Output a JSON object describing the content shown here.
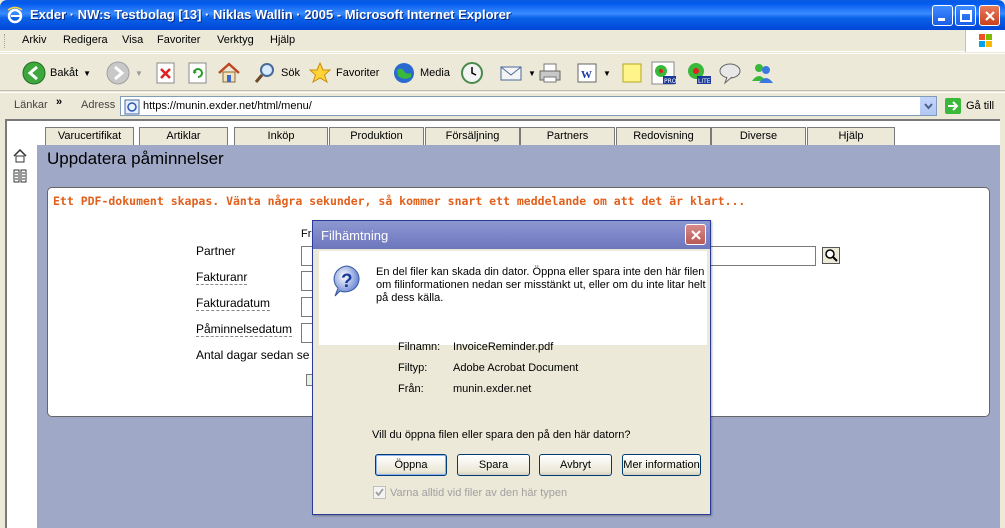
{
  "window": {
    "title": "Exder · NW:s Testbolag [13] · Niklas Wallin · 2005 - Microsoft Internet Explorer"
  },
  "menubar": {
    "items": [
      "Arkiv",
      "Redigera",
      "Visa",
      "Favoriter",
      "Verktyg",
      "Hjälp"
    ]
  },
  "toolbar": {
    "back_label": "Bakåt",
    "search_label": "Sök",
    "favorites_label": "Favoriter",
    "media_label": "Media"
  },
  "addressbar": {
    "links_label": "Länkar",
    "address_label": "Adress",
    "url": "https://munin.exder.net/html/menu/",
    "go_label": "Gå till"
  },
  "nav": {
    "tabs": [
      "Varucertifikat",
      "Artiklar",
      "Inköp",
      "Produktion",
      "Försäljning",
      "Partners",
      "Redovisning",
      "Diverse",
      "Hjälp"
    ]
  },
  "page": {
    "title": "Uppdatera påminnelser",
    "message": "Ett PDF-dokument skapas. Vänta några sekunder, så kommer snart ett meddelande om att det är klart...",
    "col_header": "Fr",
    "fields": {
      "partner": "Partner",
      "invoice_no": "Fakturanr",
      "invoice_date": "Fakturadatum",
      "reminder_date": "Påminnelsedatum",
      "days_since": "Antal dagar sedan se"
    }
  },
  "dialog": {
    "title": "Filhämtning",
    "warning": "En del filer kan skada din dator. Öppna eller spara inte den här filen om filinformationen nedan ser misstänkt ut, eller om du inte litar helt på dess källa.",
    "info": [
      {
        "label": "Filnamn:",
        "value": "InvoiceReminder.pdf"
      },
      {
        "label": "Filtyp:",
        "value": "Adobe Acrobat Document"
      },
      {
        "label": "Från:",
        "value": "munin.exder.net"
      }
    ],
    "question": "Vill du öppna filen eller spara den på den här datorn?",
    "buttons": {
      "open": "Öppna",
      "save": "Spara",
      "cancel": "Avbryt",
      "more_info": "Mer information"
    },
    "checkbox_label": "Varna alltid vid filer av den här typen",
    "checkbox_checked": true
  }
}
